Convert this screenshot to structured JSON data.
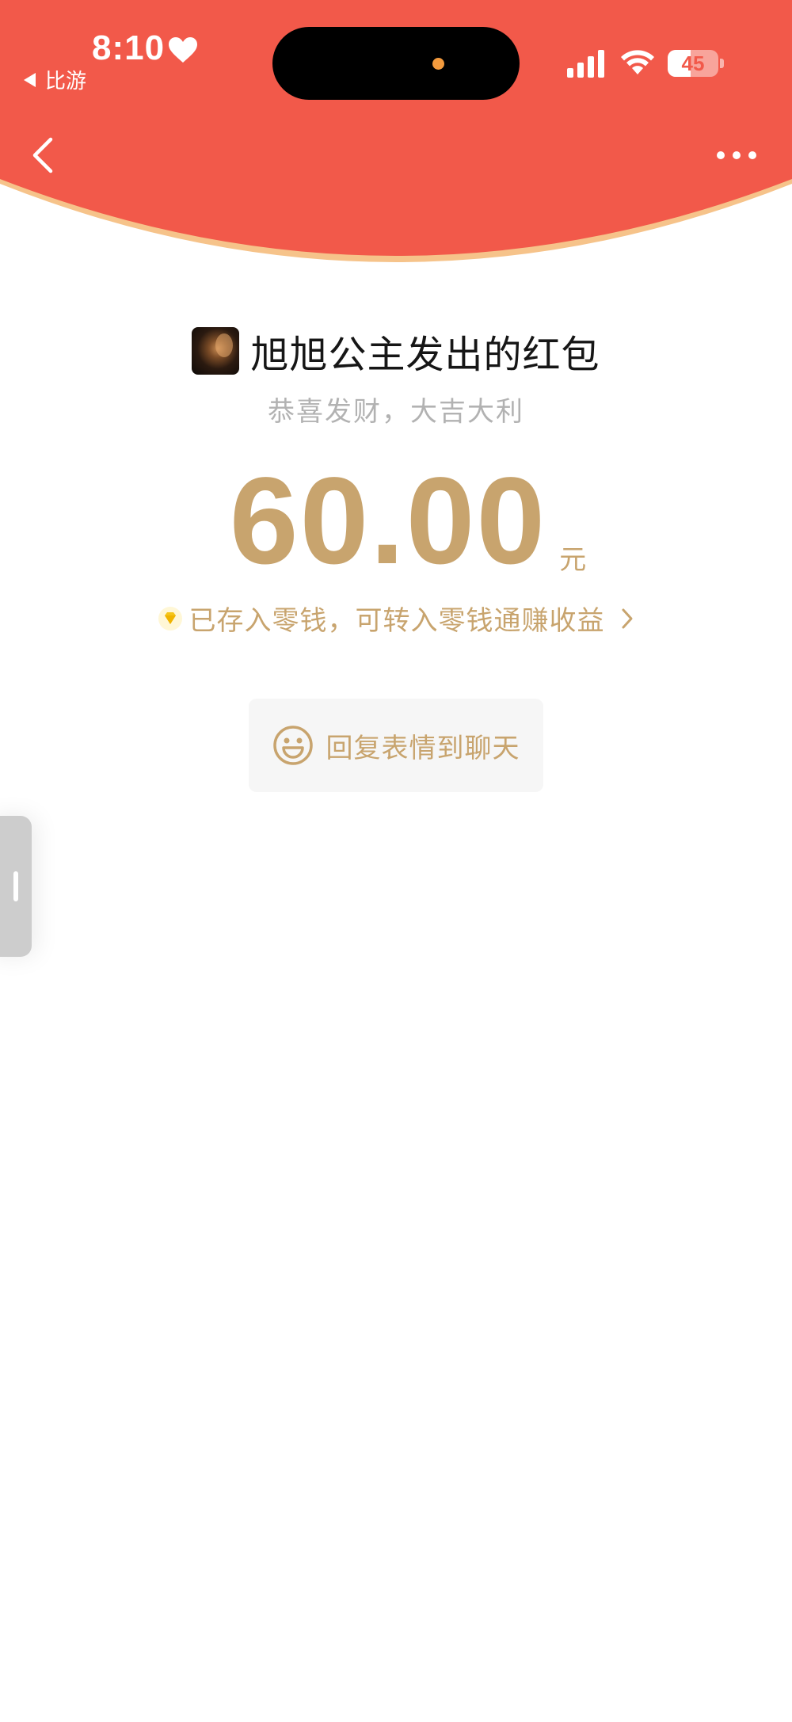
{
  "status_bar": {
    "time": "8:10",
    "back_app_label": "比游",
    "battery_level": "45",
    "battery_fraction": 0.45,
    "icons": [
      "heart-icon",
      "signal-icon",
      "wifi-icon",
      "battery-icon"
    ]
  },
  "nav": {
    "back_icon": "chevron-left-icon",
    "more_icon": "more-dots-icon"
  },
  "red_packet": {
    "sender_title": "旭旭公主发出的红包",
    "greeting": "恭喜发财，大吉大利",
    "amount": "60.00",
    "currency": "元",
    "saved_text": "已存入零钱，可转入零钱通赚收益",
    "reply_label": "回复表情到聊天"
  },
  "colors": {
    "header_red": "#f2594a",
    "header_edge": "#f6c38a",
    "gold": "#c8a46e",
    "greeting_gray": "#b2b2b2",
    "title_black": "#161616",
    "reply_bg": "#f6f6f6"
  }
}
